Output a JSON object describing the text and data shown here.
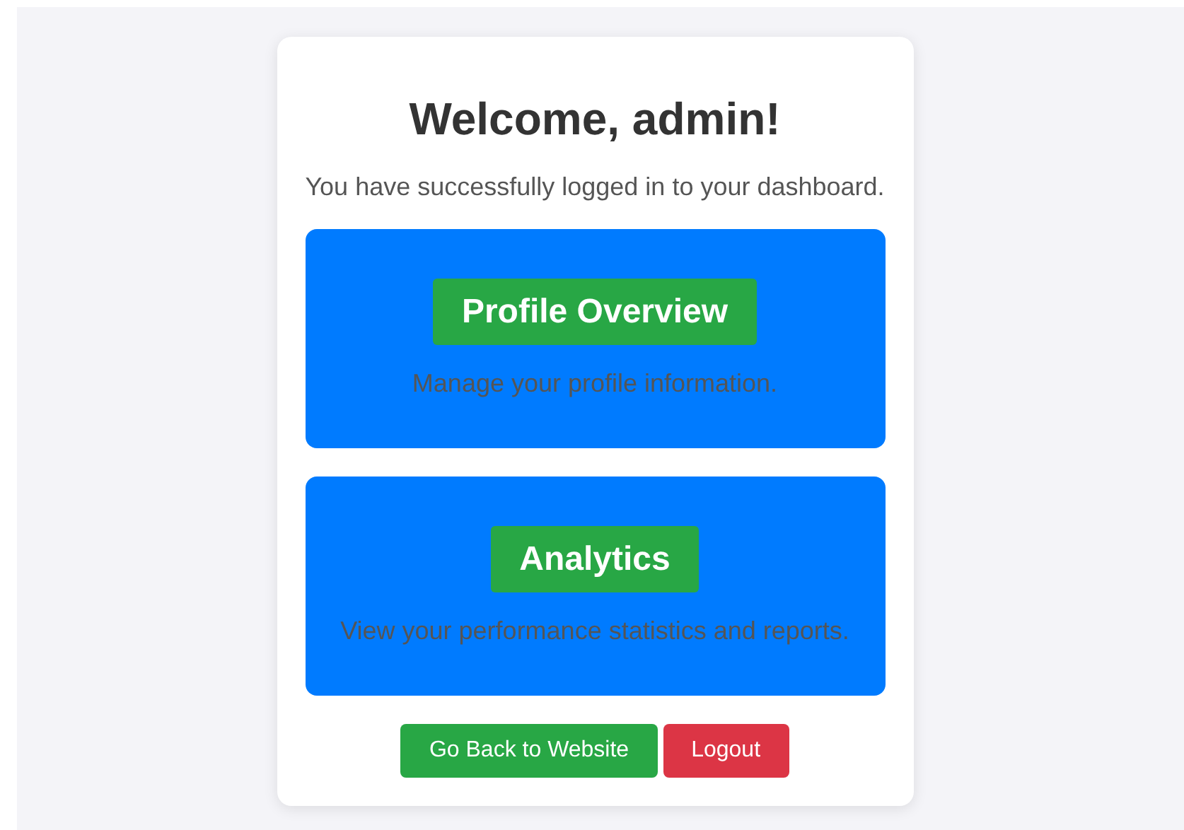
{
  "title": "Welcome, admin!",
  "subtitle": "You have successfully logged in to your dashboard.",
  "panels": [
    {
      "heading": "Profile Overview",
      "description": "Manage your profile information."
    },
    {
      "heading": "Analytics",
      "description": "View your performance statistics and reports."
    }
  ],
  "buttons": [
    {
      "label": "Go Back to Website",
      "kind": "success"
    },
    {
      "label": "Logout",
      "kind": "danger"
    }
  ]
}
